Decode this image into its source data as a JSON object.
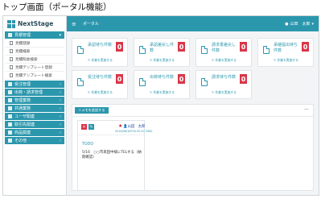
{
  "caption": "トップ画面（ポータル機能）",
  "app": {
    "logo": "NextStage"
  },
  "header": {
    "breadcrumb": "ポータル",
    "user_name": "山田　太郎"
  },
  "sidebar": {
    "sections": [
      {
        "label": "見積管理",
        "expanded": true,
        "items": [
          "見積登録",
          "見積検索",
          "見積照会検索",
          "見積テンプレート登録",
          "見積テンプレート検索"
        ]
      },
      {
        "label": "受注管理"
      },
      {
        "label": "出荷・請求管理"
      },
      {
        "label": "管理業務"
      },
      {
        "label": "共通業務"
      },
      {
        "label": "ユーザ関連"
      },
      {
        "label": "取引先関連"
      },
      {
        "label": "商品関連"
      },
      {
        "label": "その他"
      }
    ]
  },
  "cards": [
    {
      "title": "承認待ち件数",
      "count": "0",
      "link": "作業を実施する"
    },
    {
      "title": "承認差戻し件数",
      "count": "0",
      "link": "作業を実施する"
    },
    {
      "title": "請求書差戻し件数",
      "count": "0",
      "link": "作業を実施する"
    },
    {
      "title": "承継提出待ち件数",
      "count": "0",
      "link": "作業を実施する"
    },
    {
      "title": "受注待ち件数",
      "count": "0",
      "link": "作業を実施する"
    },
    {
      "title": "出荷待ち件数",
      "count": "0",
      "link": "作業を実施する"
    },
    {
      "title": "請求待ち件数",
      "count": "0",
      "link": "作業を実施する"
    }
  ],
  "memo": {
    "add_label": "＋メモを追加する",
    "collapse": "—",
    "user": "山田　太郎",
    "date": "2016/08/18T00:32:47.3382",
    "heading": "TODO",
    "text": "5/16　○○市来田中様にTELする（納期確認）"
  },
  "colors": {
    "accent": "#2b97ad",
    "badge": "#d9364a"
  }
}
